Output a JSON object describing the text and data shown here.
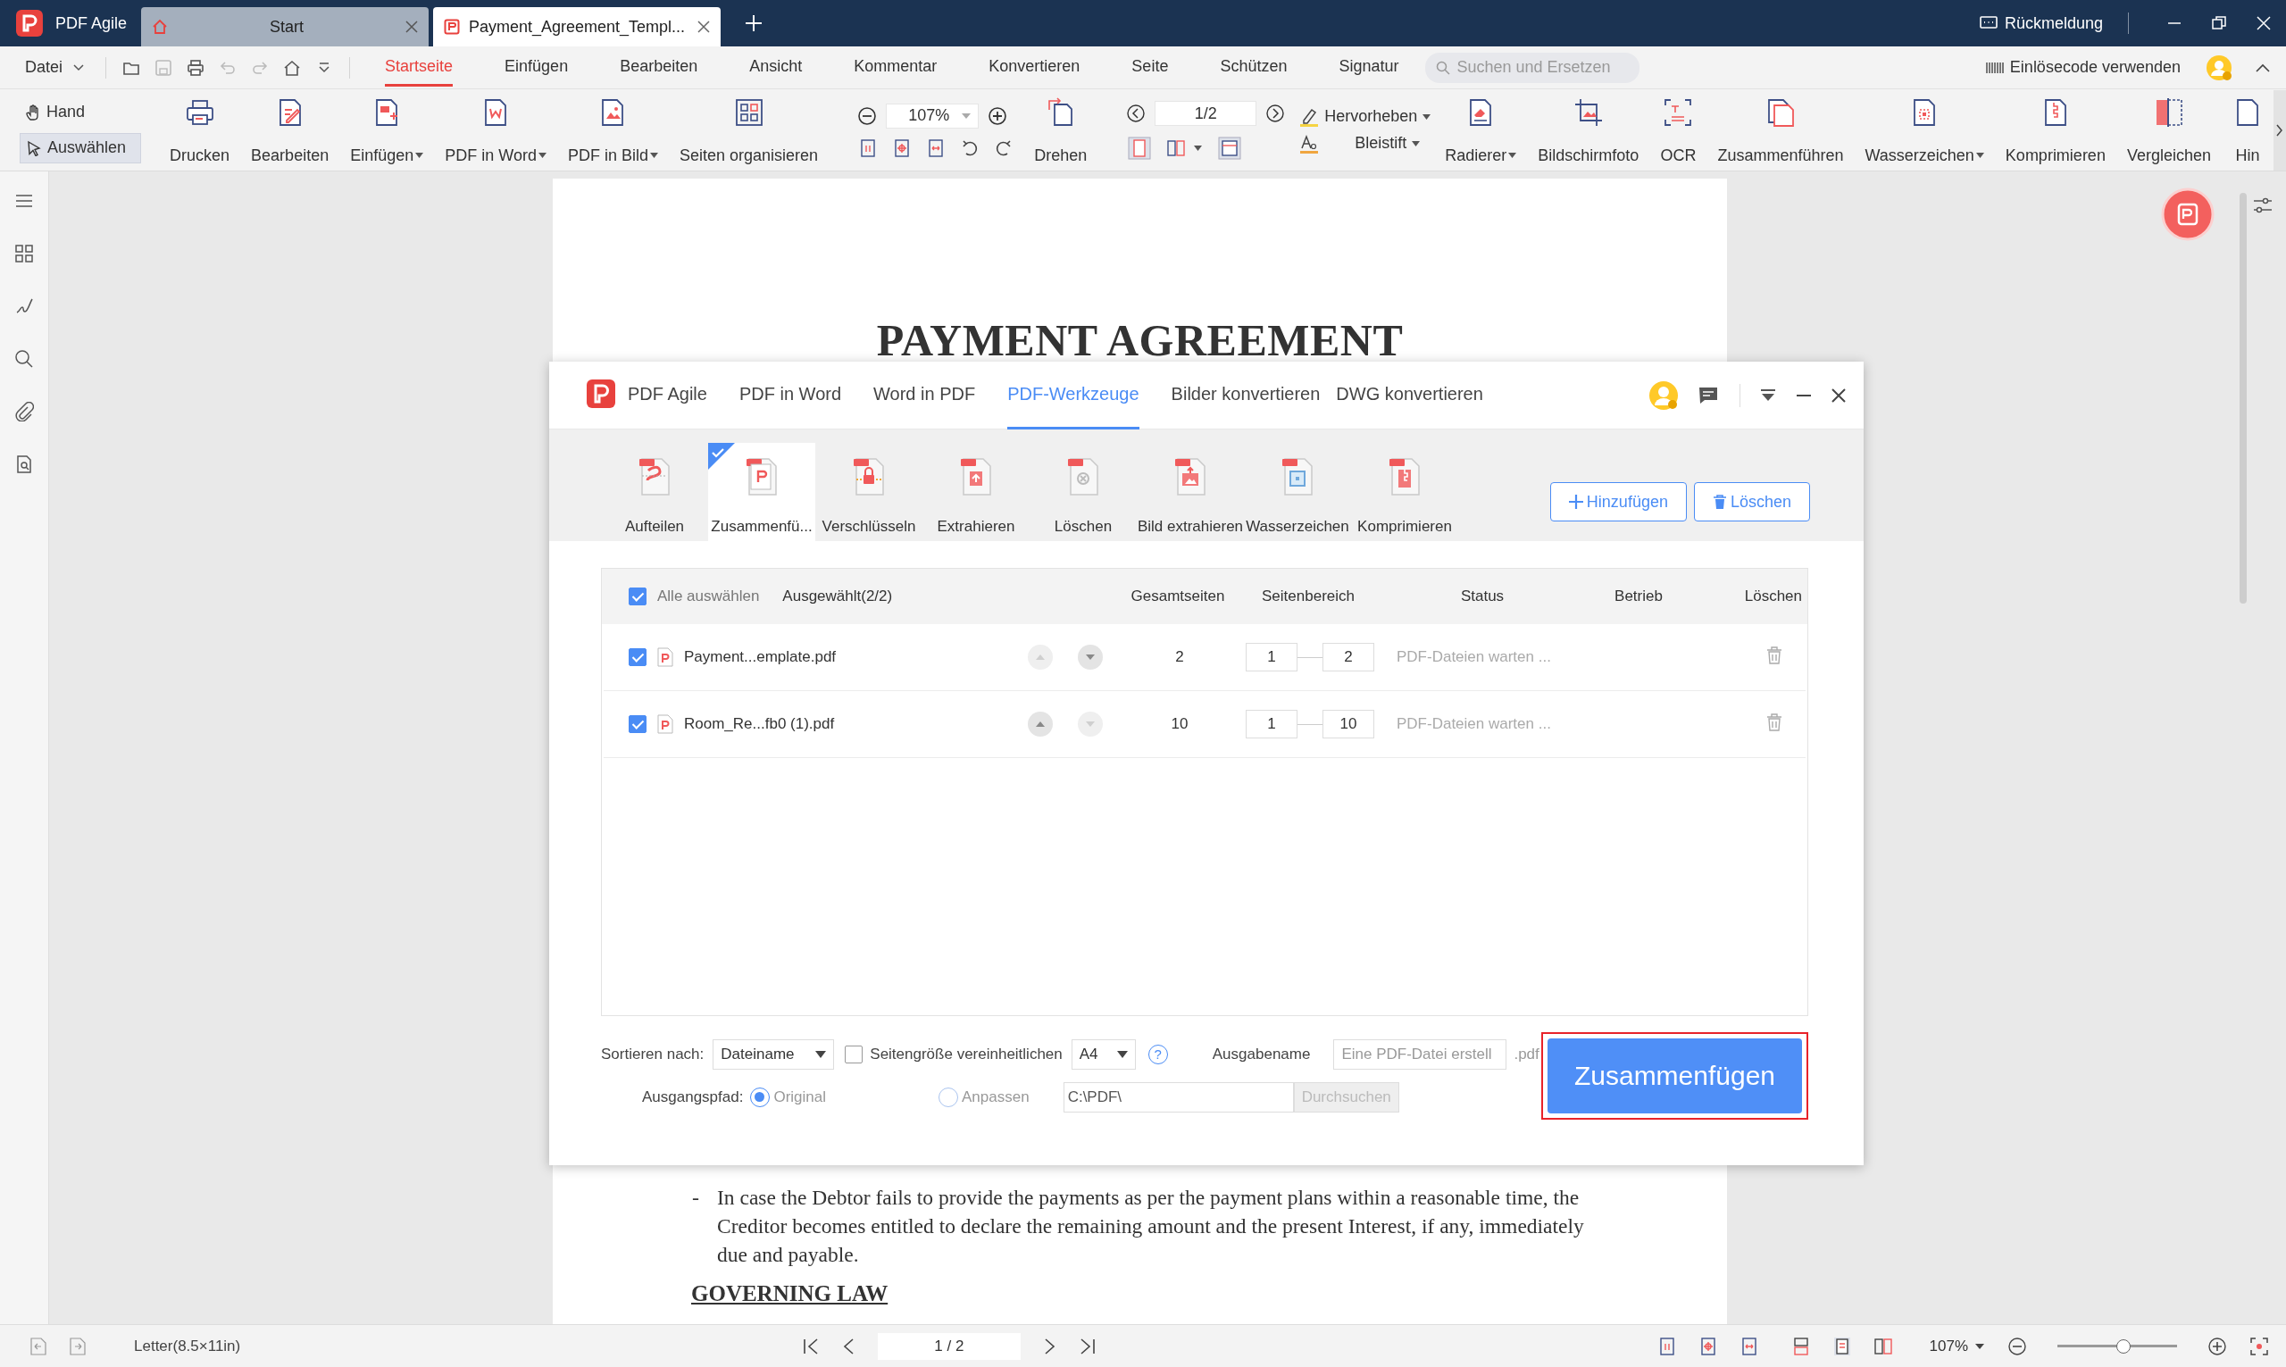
{
  "titlebar": {
    "app": "PDF Agile",
    "tabs": [
      {
        "label": "Start",
        "kind": "home",
        "selected": false
      },
      {
        "label": "Payment_Agreement_Templ...",
        "kind": "document",
        "selected": true
      }
    ],
    "feedback": "Rückmeldung"
  },
  "menu": {
    "file": "Datei",
    "tabs": [
      {
        "label": "Startseite",
        "selected": true
      },
      {
        "label": "Einfügen",
        "selected": false
      },
      {
        "label": "Bearbeiten",
        "selected": false
      },
      {
        "label": "Ansicht",
        "selected": false
      },
      {
        "label": "Kommentar",
        "selected": false
      },
      {
        "label": "Konvertieren",
        "selected": false
      },
      {
        "label": "Seite",
        "selected": false
      },
      {
        "label": "Schützen",
        "selected": false
      },
      {
        "label": "Signatur",
        "selected": false
      }
    ],
    "search": {
      "placeholder": "Suchen und Ersetzen"
    },
    "redeem": "Einlösecode verwenden"
  },
  "toolbar": {
    "modes": [
      {
        "label": "Hand",
        "selected": false
      },
      {
        "label": "Auswählen",
        "selected": true
      }
    ],
    "tools_a": [
      {
        "label": "Drucken",
        "dropdown": false
      },
      {
        "label": "Bearbeiten",
        "dropdown": false
      },
      {
        "label": "Einfügen",
        "dropdown": true
      },
      {
        "label": "PDF in Word",
        "dropdown": true
      },
      {
        "label": "PDF in Bild",
        "dropdown": true
      },
      {
        "label": "Seiten organisieren",
        "dropdown": false
      }
    ],
    "zoom": "107%",
    "rotate": "Drehen",
    "page": "1/2",
    "highlight": "Hervorheben",
    "pencil": "Bleistift",
    "tools_b": [
      {
        "label": "Radierer",
        "dropdown": true
      },
      {
        "label": "Bildschirmfoto",
        "dropdown": false
      },
      {
        "label": "OCR",
        "dropdown": false
      },
      {
        "label": "Zusammenführen",
        "dropdown": false
      },
      {
        "label": "Wasserzeichen",
        "dropdown": true
      },
      {
        "label": "Komprimieren",
        "dropdown": false
      },
      {
        "label": "Vergleichen",
        "dropdown": false
      },
      {
        "label": "Hin",
        "dropdown": false
      }
    ]
  },
  "document": {
    "title": "PAYMENT AGREEMENT",
    "bullet": "-",
    "paragraph": "In case the Debtor fails to provide the payments as per the payment plans within a reasonable time, the Creditor becomes entitled to declare the remaining amount and the present Interest, if any, immediately due and payable.",
    "heading": "GOVERNING LAW"
  },
  "dialog": {
    "tabs": [
      {
        "label": "PDF Agile",
        "kind": "logo",
        "selected": false
      },
      {
        "label": "PDF in Word",
        "kind": "text",
        "selected": false
      },
      {
        "label": "Word in PDF",
        "kind": "text",
        "selected": false
      },
      {
        "label": "PDF-Werkzeuge",
        "kind": "text",
        "selected": true
      },
      {
        "label": "Bilder konvertieren",
        "kind": "text",
        "selected": false
      },
      {
        "label": "DWG konvertieren",
        "kind": "text",
        "selected": false
      }
    ],
    "tools": [
      {
        "label": "Aufteilen",
        "selected": false
      },
      {
        "label": "Zusammenfü...",
        "selected": true
      },
      {
        "label": "Verschlüsseln",
        "selected": false
      },
      {
        "label": "Extrahieren",
        "selected": false
      },
      {
        "label": "Löschen",
        "selected": false
      },
      {
        "label": "Bild extrahieren",
        "selected": false
      },
      {
        "label": "Wasserzeichen",
        "selected": false
      },
      {
        "label": "Komprimieren",
        "selected": false
      }
    ],
    "add_button": "Hinzufügen",
    "delete_button": "Löschen",
    "table": {
      "select_all": {
        "label": "Alle auswählen",
        "checked": true
      },
      "selected_count": "Ausgewählt(2/2)",
      "columns": [
        "Gesamtseiten",
        "Seitenbereich",
        "Status",
        "Betrieb",
        "Löschen"
      ],
      "rows": [
        {
          "checked": true,
          "name": "Payment...emplate.pdf",
          "up_disabled": true,
          "down_disabled": false,
          "pages": "2",
          "from": "1",
          "to": "2",
          "status": "PDF-Dateien warten ..."
        },
        {
          "checked": true,
          "name": "Room_Re...fb0 (1).pdf",
          "up_disabled": false,
          "down_disabled": true,
          "pages": "10",
          "from": "1",
          "to": "10",
          "status": "PDF-Dateien warten ..."
        }
      ]
    },
    "sort_label": "Sortieren nach:",
    "sort_value": "Dateiname",
    "unify": {
      "label": "Seitengröße vereinheitlichen",
      "checked": false
    },
    "page_size": "A4",
    "help": "?",
    "output_label": "Ausgabename",
    "output_name": {
      "placeholder": "Eine PDF-Datei erstell"
    },
    "extension": ".pdf",
    "path_label": "Ausgangspfad:",
    "path_options": [
      {
        "label": "Original",
        "selected": true
      },
      {
        "label": "Anpassen",
        "selected": false
      }
    ],
    "path_value": "C:\\PDF\\",
    "browse": {
      "label": "Durchsuchen",
      "disabled": true
    },
    "merge_button": "Zusammenfügen"
  },
  "statusbar": {
    "paper": "Letter(8.5×11in)",
    "page": "1 / 2",
    "zoom": "107%",
    "zoom_slider": {
      "level": 0.5
    }
  }
}
